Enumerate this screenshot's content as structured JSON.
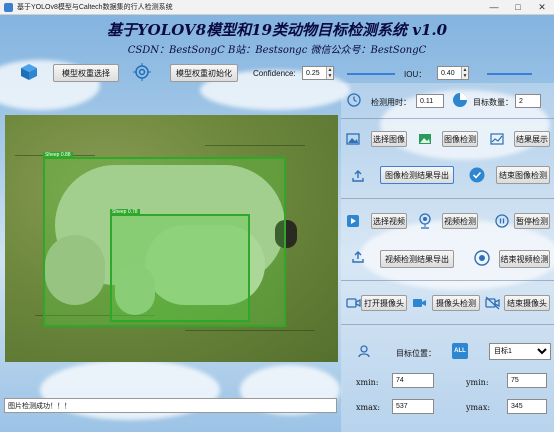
{
  "window": {
    "title": "基于YOLOv8模型与Caltech数据集的行人检测系统"
  },
  "header": {
    "title": "基于YOLOV8模型和19类动物目标检测系统 v1.0",
    "subtitle": "CSDN：BestSongC   B站：Bestsongc   微信公众号：BestSongC"
  },
  "toolbar": {
    "model_select_label": "模型权重选择",
    "model_init_label": "模型权重初始化",
    "confidence_label": "Confidence:",
    "confidence_value": "0.25",
    "iou_label": "IOU：",
    "iou_value": "0.40"
  },
  "stats": {
    "time_label": "检测用时：",
    "time_value": "0.11",
    "count_label": "目标数量：",
    "count_value": "2"
  },
  "image_section": {
    "select_label": "选择图像",
    "detect_label": "图像检测",
    "show_label": "结果展示",
    "export_label": "图像检测结果导出",
    "end_label": "结束图像检测"
  },
  "video_section": {
    "select_label": "选择视频",
    "detect_label": "视频检测",
    "pause_label": "暂停检测",
    "export_label": "视频检测结果导出",
    "end_label": "结束视频检测"
  },
  "camera_section": {
    "open_label": "打开摄像头",
    "detect_label": "摄像头检测",
    "end_label": "结束摄像头"
  },
  "target": {
    "position_label": "目标位置：",
    "all_badge": "ALL",
    "selected": "目标1",
    "xmin_label": "xmin:",
    "xmin_value": "74",
    "ymin_label": "ymin:",
    "ymin_value": "75",
    "xmax_label": "xmax:",
    "xmax_value": "537",
    "ymax_label": "ymax:",
    "ymax_value": "345"
  },
  "detections": [
    {
      "label": "Sheep 0.88"
    },
    {
      "label": "Sheep 0.78"
    }
  ],
  "status_text": "图片检测成功！！！",
  "colors": {
    "accent": "#3d7fd6",
    "box": "#2fa82a",
    "title": "#0b0b40"
  }
}
